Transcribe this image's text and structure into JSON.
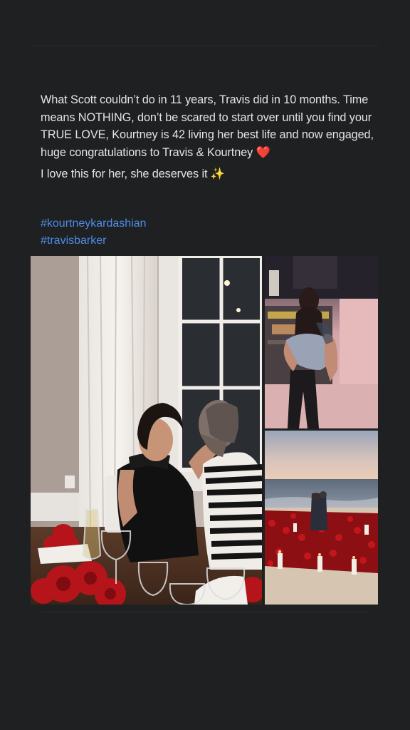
{
  "post": {
    "text_line1": "What Scott couldn’t do in 11 years, Travis did in 10 months. Time means NOTHING, don’t be scared to start over until you find your TRUE LOVE, Kourtney is 42 living her best life and now engaged, huge congratulations to Travis & Kourtney",
    "text_line1_emoji": "❤️",
    "text_line2": "I love this for her, she deserves it",
    "text_line2_emoji": "✨",
    "hashtags": [
      "#kourtneykardashian",
      "#travisbarker"
    ]
  },
  "colors": {
    "background": "#1f2022",
    "text": "#e4e4e6",
    "hashtag": "#4e8ce6"
  },
  "photos": [
    {
      "name": "couple-kiss-dinner"
    },
    {
      "name": "couple-studio"
    },
    {
      "name": "beach-proposal-roses"
    }
  ]
}
